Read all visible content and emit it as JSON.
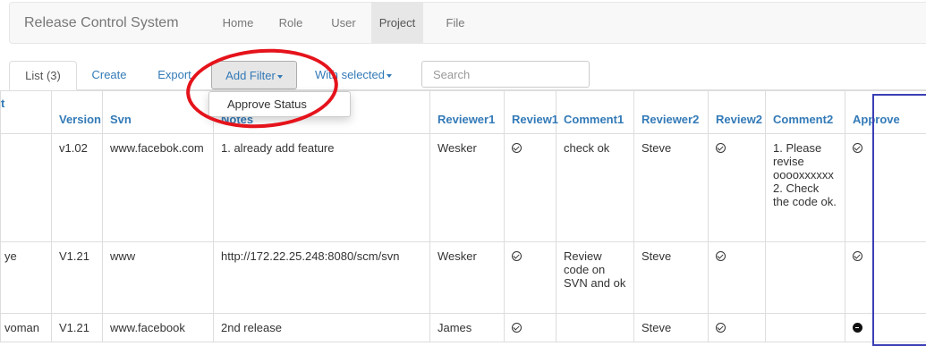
{
  "navbar": {
    "brand": "Release Control System",
    "links": [
      "Home",
      "Role",
      "User",
      "Project",
      "File"
    ],
    "active": "Project"
  },
  "tabs": {
    "list": "List (3)",
    "create": "Create",
    "export": "Export",
    "add_filter": "Add Filter",
    "with_selected": "With selected"
  },
  "search": {
    "placeholder": "Search"
  },
  "dropdown": {
    "items": [
      "Approve Status"
    ]
  },
  "table": {
    "columns": [
      "t",
      "Version",
      "Svn",
      "Notes",
      "Reviewer1",
      "Review1",
      "Comment1",
      "Reviewer2",
      "Review2",
      "Comment2",
      "Approve"
    ],
    "rows": [
      {
        "project": "",
        "version": "v1.02",
        "svn": "www.facebok.com",
        "notes": "1. already add feature",
        "reviewer1": "Wesker",
        "review1": "check-circle-icon",
        "comment1": "check ok",
        "reviewer2": "Steve",
        "review2": "check-circle-icon",
        "comment2": "1. Please revise ooooxxxxxx 2. Check the code ok.",
        "approve": "check-circle-icon"
      },
      {
        "project": "ye",
        "version": "V1.21",
        "svn": "www",
        "notes": "http://172.22.25.248:8080/scm/svn",
        "reviewer1": "Wesker",
        "review1": "check-circle-icon",
        "comment1": "Review code on SVN and ok",
        "reviewer2": "Steve",
        "review2": "check-circle-icon",
        "comment2": "",
        "approve": "check-circle-icon"
      },
      {
        "project": "voman",
        "version": "V1.21",
        "svn": "www.facebook",
        "notes": "2nd release",
        "reviewer1": "James",
        "review1": "check-circle-icon",
        "comment1": "",
        "reviewer2": "Steve",
        "review2": "check-circle-icon",
        "comment2": "",
        "approve": "minus-circle-icon"
      }
    ]
  },
  "colors": {
    "link": "#337ab7",
    "annotation_red": "#e5131b",
    "annotation_blue": "#3b3fb5"
  }
}
